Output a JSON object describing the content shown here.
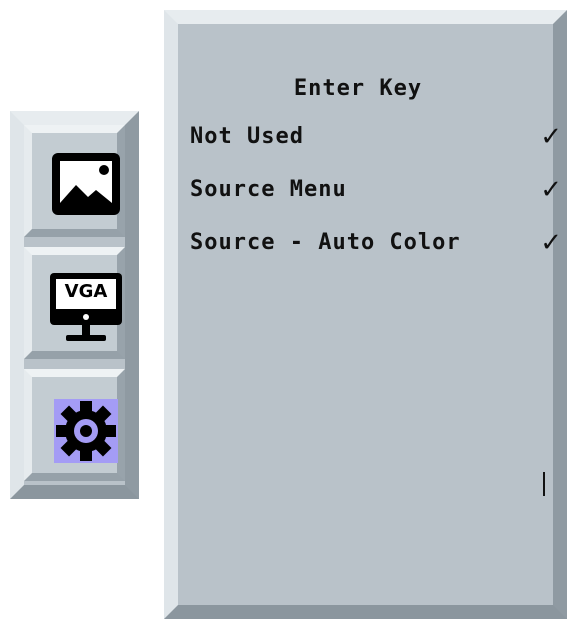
{
  "sidebar": {
    "tabs": [
      {
        "icon": "picture-icon"
      },
      {
        "icon": "vga-monitor-icon",
        "badge": "VGA"
      },
      {
        "icon": "gear-icon"
      }
    ]
  },
  "menu": {
    "title": "Enter Key",
    "items": [
      {
        "label": "Not Used",
        "check": "✓"
      },
      {
        "label": "Source Menu",
        "check": "✓"
      },
      {
        "label": "Source - Auto Color",
        "check": "✓"
      }
    ]
  },
  "colors": {
    "panel": "#b9c2c9",
    "selected_tab_highlight": "#a49cf5",
    "icon_black": "#000000"
  }
}
